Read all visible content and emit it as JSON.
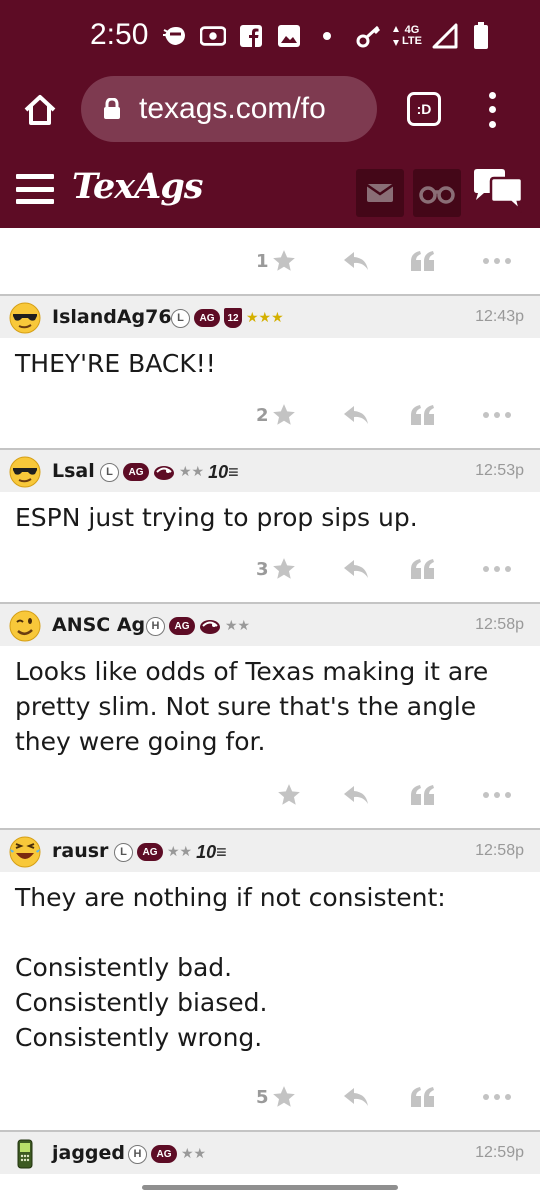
{
  "status_bar": {
    "time": "2:50",
    "network": "4G",
    "network_sub": "LTE",
    "icons_left": [
      "ninja-icon",
      "radio-icon",
      "facebook-icon",
      "image-icon",
      "dot-icon"
    ],
    "icons_right": [
      "key-icon",
      "data-arrows-icon",
      "signal-icon",
      "battery-icon"
    ]
  },
  "browser": {
    "url": "texags.com/fo",
    "tab_label": ":D"
  },
  "site": {
    "logo": "TexAgs",
    "colors": {
      "maroon": "#5d0c25",
      "dark_maroon": "#440718"
    }
  },
  "top_fragment": {
    "like_count": "1"
  },
  "posts": [
    {
      "username": "IslandAg76",
      "status_letter": "L",
      "ag": "AG",
      "shield": "12",
      "stars": "★★★",
      "time": "12:43p",
      "lines": [
        "THEY'RE BACK!!"
      ],
      "like_count": "2"
    },
    {
      "username": "Lsal",
      "status_letter": "L",
      "ag": "AG",
      "stars": "★★",
      "rank": "10≡",
      "time": "12:53p",
      "lines": [
        "ESPN just trying to prop sips up."
      ],
      "like_count": "3"
    },
    {
      "username": "ANSC Ag",
      "status_letter": "H",
      "ag": "AG",
      "stars": "★★",
      "time": "12:58p",
      "lines": [
        "Looks like odds of Texas making it are",
        "pretty slim. Not sure that's the angle",
        "they were going for."
      ],
      "like_count": ""
    },
    {
      "username": "rausr",
      "status_letter": "L",
      "ag": "AG",
      "stars": "★★",
      "rank": "10≡",
      "time": "12:58p",
      "lines": [
        "They are nothing if not consistent:",
        "",
        "Consistently bad.",
        "Consistently biased.",
        "Consistently wrong."
      ],
      "like_count": "5"
    },
    {
      "username": "jagged",
      "status_letter": "H",
      "ag": "AG",
      "stars": "★★",
      "time": "12:59p"
    }
  ]
}
